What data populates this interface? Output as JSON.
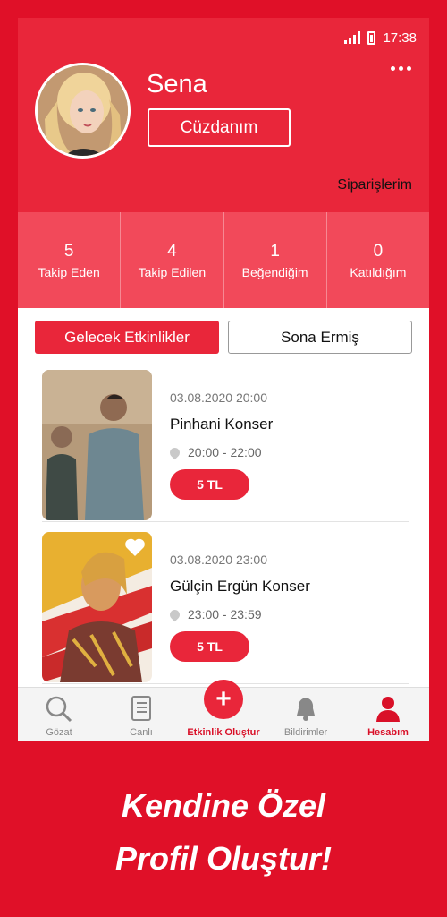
{
  "statusbar": {
    "time": "17:38"
  },
  "profile": {
    "name": "Sena",
    "wallet_label": "Cüzdanım",
    "orders_label": "Siparişlerim"
  },
  "stats": [
    {
      "num": "5",
      "label": "Takip Eden"
    },
    {
      "num": "4",
      "label": "Takip Edilen"
    },
    {
      "num": "1",
      "label": "Beğendiğim"
    },
    {
      "num": "0",
      "label": "Katıldığım"
    }
  ],
  "tabs": {
    "upcoming": "Gelecek Etkinlikler",
    "past": "Sona Ermiş"
  },
  "events": [
    {
      "date": "03.08.2020 20:00",
      "title": "Pinhani Konser",
      "time": "20:00 - 22:00",
      "price": "5 TL"
    },
    {
      "date": "03.08.2020 23:00",
      "title": "Gülçin Ergün Konser",
      "time": "23:00 - 23:59",
      "price": "5 TL"
    }
  ],
  "nav": {
    "browse": "Gözat",
    "live": "Canlı",
    "create": "Etkinlik Oluştur",
    "notifications": "Bildirimler",
    "account": "Hesabım"
  },
  "promo": {
    "line1": "Kendine Özel",
    "line2": "Profil Oluştur!"
  },
  "colors": {
    "brand": "#e9263a",
    "background": "#e01028",
    "stats_bar": "#f2495a"
  }
}
